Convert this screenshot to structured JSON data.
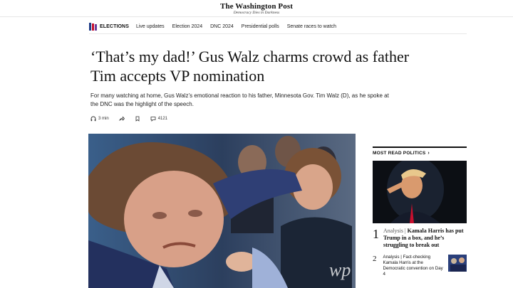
{
  "masthead": {
    "logo": "The Washington Post",
    "tagline": "Democracy Dies in Darkness"
  },
  "nav": {
    "brand": "ELECTIONS",
    "links": [
      "Live updates",
      "Election 2024",
      "DNC 2024",
      "Presidential polls",
      "Senate races to watch"
    ]
  },
  "article": {
    "headline": "‘That’s my dad!’ Gus Walz charms crowd as father Tim accepts VP nomination",
    "dek": "For many watching at home, Gus Walz’s emotional reaction to his father, Minnesota Gov. Tim Walz (D), as he spoke at the DNC was the highlight of the speech.",
    "listen_time": "3 min",
    "comment_count": "4121",
    "watermark": "wp"
  },
  "sidebar": {
    "most_read_header": "MOST READ POLITICS",
    "items": [
      {
        "number": "1",
        "label": "Analysis",
        "title": "Kamala Harris has put Trump in a box, and he’s struggling to break out"
      },
      {
        "number": "2",
        "label": "Analysis",
        "title": "Fact-checking Kamala Harris at the Democratic convention on Day 4"
      }
    ]
  },
  "colors": {
    "ballot_red": "#c8102e",
    "ballot_blue": "#1f3c88",
    "text": "#111111"
  }
}
